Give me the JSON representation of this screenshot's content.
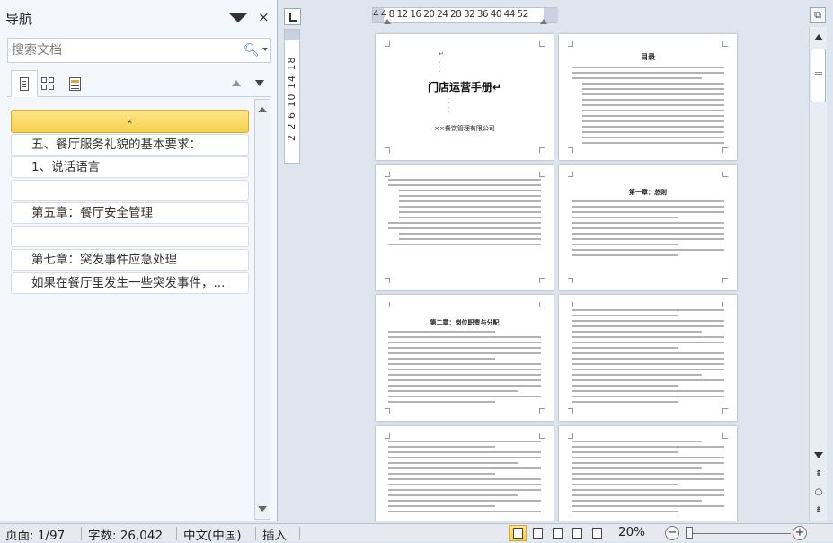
{
  "nav_pane": {
    "title": "导航",
    "close_label": "×",
    "search_placeholder": "搜索文档",
    "headings": [
      "",
      "五、餐厅服务礼貌的基本要求：",
      "1、说话语言",
      "",
      "第五章：餐厅安全管理",
      "",
      "第七章：突发事件应急处理",
      "如果在餐厅里发生一些突发事件，..."
    ],
    "collapse_glyph": "⌅"
  },
  "ruler": {
    "horizontal_numbers": "4  4  8 12 16 20 24 28 32 36 40 44   52",
    "vertical_numbers": "2  2  6  10  14  18"
  },
  "pages": {
    "p1_title": "门店运营手册↵",
    "p1_company": "××餐饮管理有限公司",
    "p2_title": "目录",
    "p4_heading": "第一章：总则",
    "p5_heading": "第二章：岗位职责与分配"
  },
  "status_bar": {
    "page": "页面: 1/97",
    "words": "字数: 26,042",
    "language": "中文(中国)",
    "mode": "插入",
    "zoom": "20%",
    "zoom_minus": "−",
    "zoom_plus": "+"
  },
  "colors": {
    "selected_heading": "#f6cf4c",
    "workspace": "#dfe5ee"
  }
}
